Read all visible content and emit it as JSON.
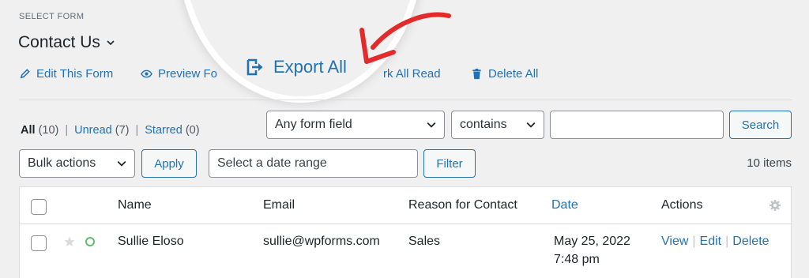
{
  "header": {
    "select_form_label": "SELECT FORM",
    "form_name": "Contact Us"
  },
  "actions": {
    "edit_form": "Edit This Form",
    "preview_form": "Preview Fo",
    "export_all": "Export All",
    "mark_all_read": "rk All Read",
    "delete_all": "Delete All"
  },
  "status": {
    "all_label": "All",
    "all_count": "(10)",
    "unread_label": "Unread",
    "unread_count": "(7)",
    "starred_label": "Starred",
    "starred_count": "(0)",
    "separator": "|"
  },
  "search": {
    "field_select": "Any form field",
    "operator_select": "contains",
    "query_value": "",
    "button": "Search"
  },
  "filters": {
    "bulk_actions": "Bulk actions",
    "apply": "Apply",
    "date_placeholder": "Select a date range",
    "filter": "Filter",
    "items_count": "10 items"
  },
  "table": {
    "columns": [
      "Name",
      "Email",
      "Reason for Contact",
      "Date",
      "Actions"
    ],
    "rows": [
      {
        "name": "Sullie Eloso",
        "email": "sullie@wpforms.com",
        "reason": "Sales",
        "date_line1": "May 25, 2022",
        "date_line2": "7:48 pm",
        "actions": [
          "View",
          "Edit",
          "Delete"
        ]
      }
    ]
  },
  "colors": {
    "link": "#2271b1",
    "annotation_arrow": "#e22b2b"
  },
  "icons": [
    "pencil-icon",
    "eye-icon",
    "export-icon",
    "trash-icon",
    "chevron-down-icon",
    "gear-icon",
    "star-icon",
    "unread-dot-icon"
  ]
}
